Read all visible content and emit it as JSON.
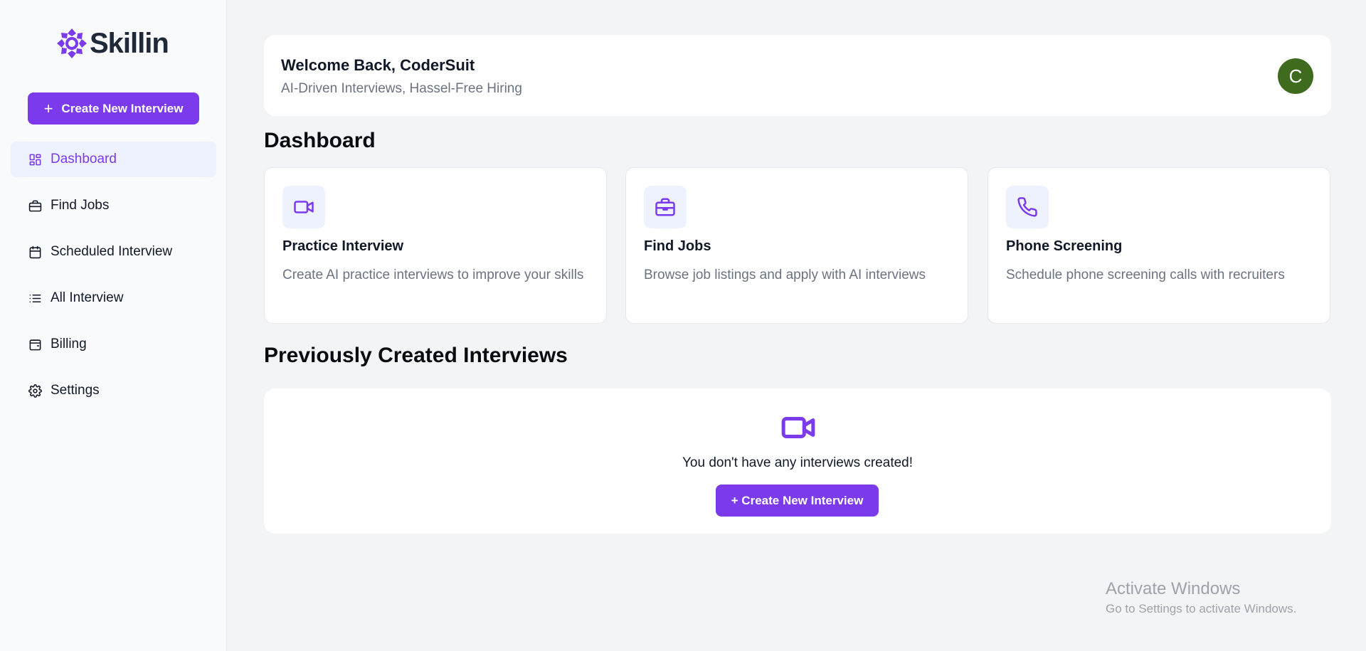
{
  "brand": {
    "name": "Skillin",
    "accent": "#7c3aed"
  },
  "sidebar": {
    "create_button": "Create New Interview",
    "items": [
      {
        "label": "Dashboard",
        "icon": "dashboard-icon",
        "active": true
      },
      {
        "label": "Find Jobs",
        "icon": "briefcase-icon"
      },
      {
        "label": "Scheduled Interview",
        "icon": "calendar-icon"
      },
      {
        "label": "All Interview",
        "icon": "list-icon"
      },
      {
        "label": "Billing",
        "icon": "wallet-icon"
      },
      {
        "label": "Settings",
        "icon": "gear-icon"
      }
    ]
  },
  "header": {
    "title": "Welcome Back, CoderSuit",
    "subtitle": "AI-Driven Interviews, Hassel-Free Hiring",
    "avatar_initial": "C",
    "avatar_color": "#3f6b1f"
  },
  "dashboard": {
    "title": "Dashboard",
    "cards": [
      {
        "title": "Practice Interview",
        "description": "Create AI practice interviews to improve your skills",
        "icon": "video-icon"
      },
      {
        "title": "Find Jobs",
        "description": "Browse job listings and apply with AI interviews",
        "icon": "briefcase-icon"
      },
      {
        "title": "Phone Screening",
        "description": "Schedule phone screening calls with recruiters",
        "icon": "phone-icon"
      }
    ]
  },
  "previous": {
    "title": "Previously Created Interviews",
    "empty_text": "You don't have any interviews created!",
    "empty_button": "+ Create New Interview",
    "icon": "video-icon"
  },
  "watermark": {
    "title": "Activate Windows",
    "subtitle": "Go to Settings to activate Windows."
  }
}
